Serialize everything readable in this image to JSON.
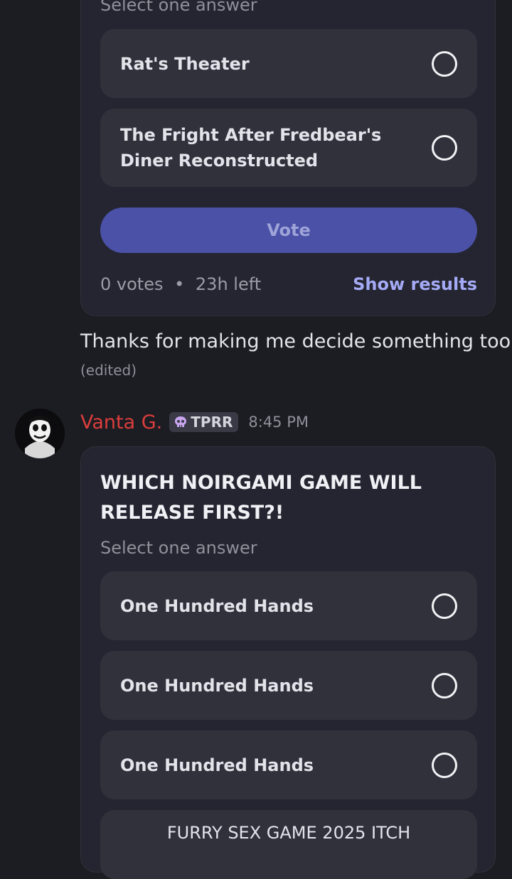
{
  "poll1": {
    "subtitle": "Select one answer",
    "options": [
      {
        "label": "Rat's Theater"
      },
      {
        "label": "The Fright After Fredbear's Diner Reconstructed"
      }
    ],
    "vote_label": "Vote",
    "votes": "0 votes",
    "separator": "•",
    "time_left": "23h left",
    "show_results": "Show results"
  },
  "message": {
    "text": "Thanks for making me decide something too",
    "edited": "(edited)"
  },
  "author": {
    "name": "Vanta G.",
    "tag": "TPRR",
    "time": "8:45 PM"
  },
  "poll2": {
    "question": "WHICH NOIRGAMI GAME WILL RELEASE FIRST?!",
    "subtitle": "Select one answer",
    "options": [
      {
        "label": "One Hundred Hands"
      },
      {
        "label": "One Hundred Hands"
      },
      {
        "label": "One Hundred Hands"
      },
      {
        "label": "FURRY SEX GAME 2025 ITCH"
      }
    ]
  },
  "colors": {
    "background": "#1c1d22",
    "card": "#242530",
    "option": "#30313b",
    "vote_button": "#4a51a6",
    "link": "#a4aaf5",
    "author_name": "#dc3d3d"
  }
}
